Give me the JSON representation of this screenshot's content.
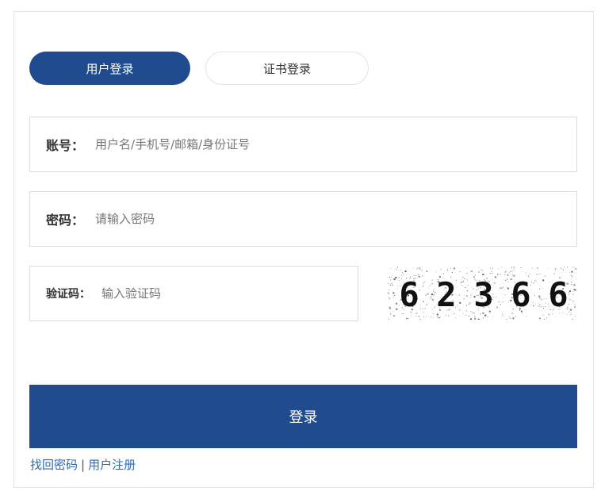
{
  "tabs": {
    "user_login": "用户登录",
    "cert_login": "证书登录"
  },
  "account": {
    "label": "账号：",
    "placeholder": "用户名/手机号/邮箱/身份证号",
    "value": ""
  },
  "password": {
    "label": "密码：",
    "placeholder": "请输入密码",
    "value": ""
  },
  "captcha": {
    "label": "验证码：",
    "placeholder": "输入验证码",
    "value": "",
    "image_text": [
      "6",
      "2",
      "3",
      "6",
      "6"
    ]
  },
  "login_button": "登录",
  "links": {
    "forgot_password": "找回密码",
    "separator": "|",
    "register": "用户注册"
  },
  "colors": {
    "brand": "#214b8f",
    "link": "#2d6ab3"
  }
}
